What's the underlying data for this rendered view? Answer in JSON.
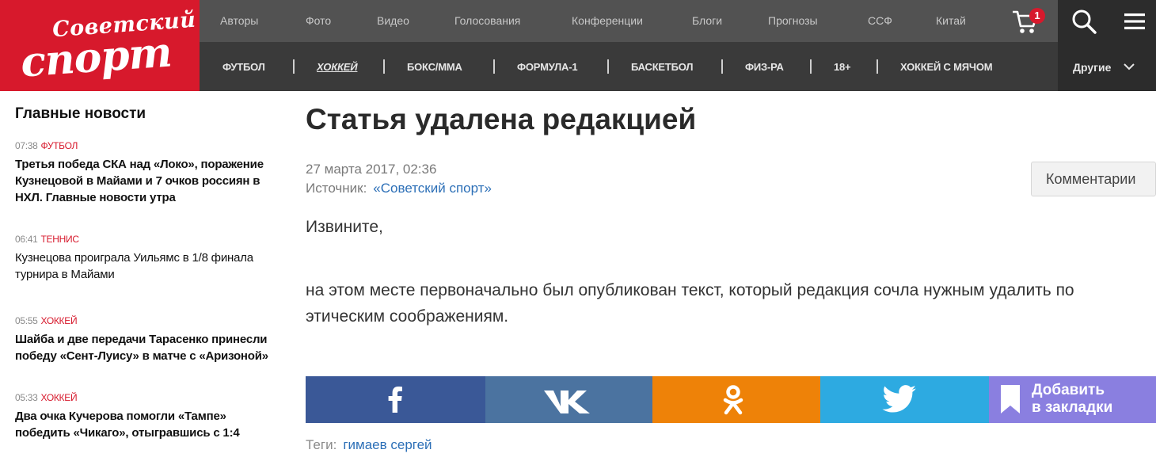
{
  "logo": {
    "line1": "Советский",
    "line2": "спорт"
  },
  "top_nav": {
    "items": [
      "Авторы",
      "Фото",
      "Видео",
      "Голосования",
      "Конференции",
      "Блоги",
      "Прогнозы",
      "ССФ",
      "Китай"
    ],
    "cart_badge": "1"
  },
  "sport_nav": {
    "items": [
      "ФУТБОЛ",
      "ХОККЕЙ",
      "БОКС/ММА",
      "ФОРМУЛА-1",
      "БАСКЕТБОЛ",
      "ФИЗ-РА",
      "18+",
      "ХОККЕЙ С МЯЧОМ"
    ],
    "active_index": 1,
    "other_label": "Другие"
  },
  "sidebar": {
    "title": "Главные новости",
    "news": [
      {
        "time": "07:38",
        "category": "ФУТБОЛ",
        "title": "Третья победа СКА над «Локо», поражение Кузнецовой в Майами и 7 очков россиян в НХЛ. Главные новости утра",
        "bold": true
      },
      {
        "time": "06:41",
        "category": "ТЕННИС",
        "title": "Кузнецова проиграла Уильямс в 1/8 финала турнира в Майами",
        "bold": false
      },
      {
        "time": "05:55",
        "category": "ХОККЕЙ",
        "title": "Шайба и две передачи Тарасенко принесли победу «Сент-Луису» в матче с «Аризоной»",
        "bold": true
      },
      {
        "time": "05:33",
        "category": "ХОККЕЙ",
        "title": "Два очка Кучерова помогли «Тампе» победить «Чикаго», отыгравшись с 1:4",
        "bold": true
      }
    ]
  },
  "article": {
    "title": "Статья удалена редакцией",
    "date": "27 марта 2017, 02:36",
    "source_label": "Источник:",
    "source_name": "«Советский спорт»",
    "comments_button": "Комментарии",
    "paragraph1": "Извините,",
    "paragraph2": "на этом месте первоначально был опубликован текст, который редакция сочла нужным удалить по этическим соображениям."
  },
  "share": {
    "bookmark_line1": "Добавить",
    "bookmark_line2": "в закладки",
    "icons": [
      "facebook-icon",
      "vk-icon",
      "odnoklassniki-icon",
      "twitter-icon",
      "bookmark-icon"
    ],
    "colors": {
      "facebook": "#3a5897",
      "vk": "#4b73a0",
      "ok": "#ee8208",
      "twitter": "#2daae1",
      "bookmark": "#8a7fe0"
    }
  },
  "tags": {
    "label": "Теги:",
    "items": [
      "гимаев сергей"
    ]
  },
  "colors": {
    "brand": "#d7192c",
    "link": "#2c6fb7"
  }
}
